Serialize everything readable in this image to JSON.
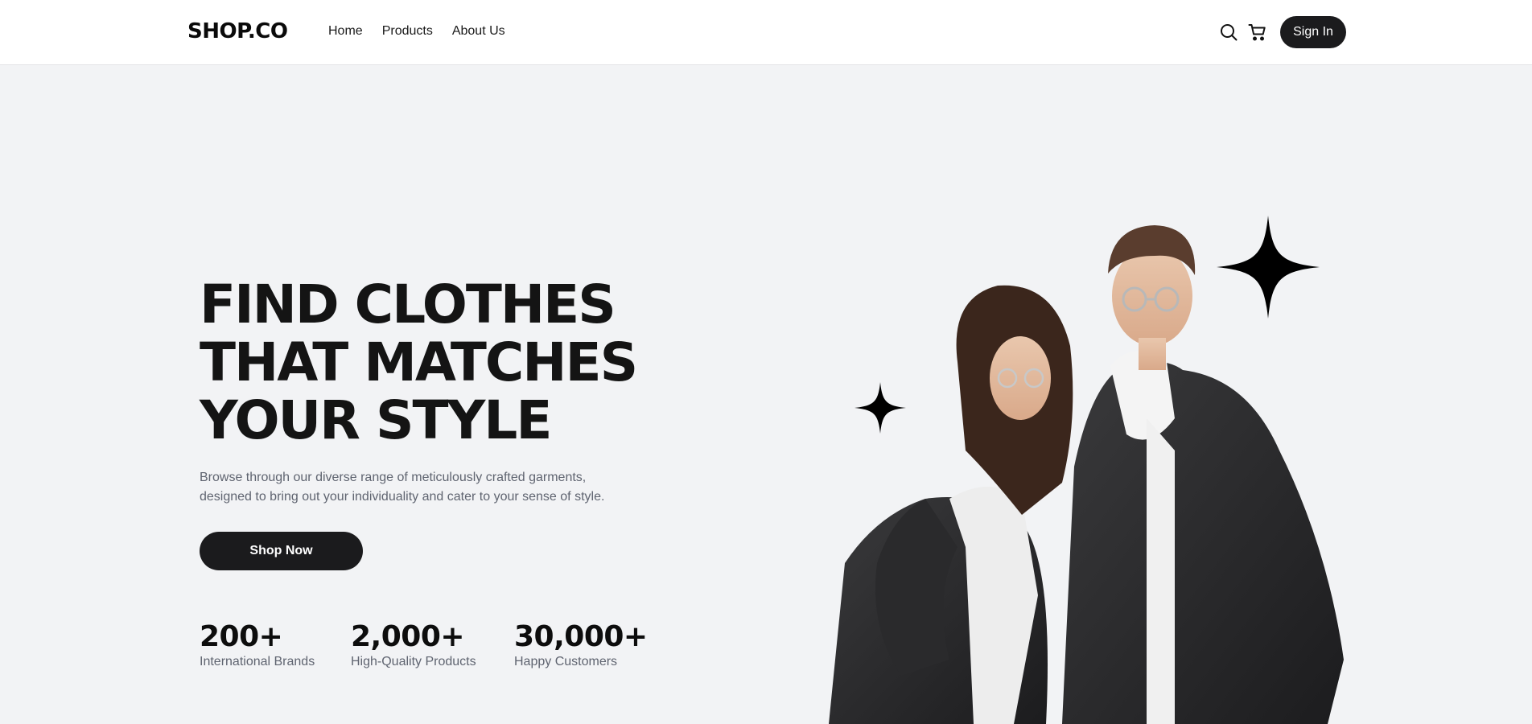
{
  "header": {
    "logo": "SHOP.CO",
    "nav": [
      {
        "label": "Home"
      },
      {
        "label": "Products"
      },
      {
        "label": "About Us"
      }
    ],
    "icons": {
      "search": "search-icon",
      "cart": "cart-icon"
    },
    "sign_in_label": "Sign In"
  },
  "hero": {
    "title_lines": [
      "FIND CLOTHES",
      "THAT MATCHES",
      "YOUR STYLE"
    ],
    "description_lines": [
      "Browse through our diverse range of meticulously crafted garments,",
      "designed to bring out your individuality and cater to your sense of style."
    ],
    "cta_label": "Shop Now",
    "stats": [
      {
        "value": "200+",
        "label": "International Brands"
      },
      {
        "value": "2,000+",
        "label": "High-Quality Products"
      },
      {
        "value": "30,000+",
        "label": "Happy Customers"
      }
    ]
  },
  "colors": {
    "page_background": "#f2f3f5",
    "header_background": "#ffffff",
    "primary_dark": "#1b1b1d",
    "text_muted": "#5f6470"
  }
}
